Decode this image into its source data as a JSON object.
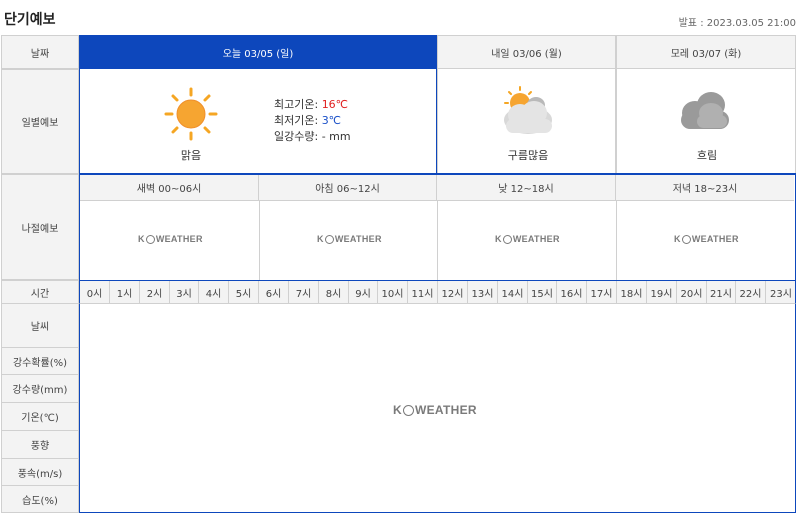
{
  "title": "단기예보",
  "announce": "발표 : 2023.03.05 21:00",
  "labels": {
    "date": "날짜",
    "daily": "일별예보",
    "period": "나절예보",
    "time": "시간",
    "weather": "날씨",
    "precip_prob": "강수확률(%)",
    "precip_amt": "강수량(mm)",
    "temp": "기온(℃)",
    "wind_dir": "풍향",
    "wind_speed": "풍속(m/s)",
    "humidity": "습도(%)"
  },
  "days": [
    {
      "date": "오늘 03/05 (일)",
      "condition": "맑음",
      "icon": "sun-icon"
    },
    {
      "date": "내일 03/06 (월)",
      "condition": "구름많음",
      "icon": "partly-cloudy-icon"
    },
    {
      "date": "모레 03/07 (화)",
      "condition": "흐림",
      "icon": "cloudy-icon"
    }
  ],
  "today_detail": {
    "max_label": "최고기온:",
    "max_value": "16℃",
    "min_label": "최저기온:",
    "min_value": "3℃",
    "rain_label": "일강수량:",
    "rain_value": "- mm"
  },
  "periods": [
    "새벽 00~06시",
    "아침 06~12시",
    "낮 12~18시",
    "저녁 18~23시"
  ],
  "logo": {
    "pre": "K",
    "post": "WEATHER"
  },
  "hours": [
    "0시",
    "1시",
    "2시",
    "3시",
    "4시",
    "5시",
    "6시",
    "7시",
    "8시",
    "9시",
    "10시",
    "11시",
    "12시",
    "13시",
    "14시",
    "15시",
    "16시",
    "17시",
    "18시",
    "19시",
    "20시",
    "21시",
    "22시",
    "23시"
  ],
  "colors": {
    "accent": "#0d47bc",
    "high": "#e02020",
    "low": "#1a50c8"
  }
}
